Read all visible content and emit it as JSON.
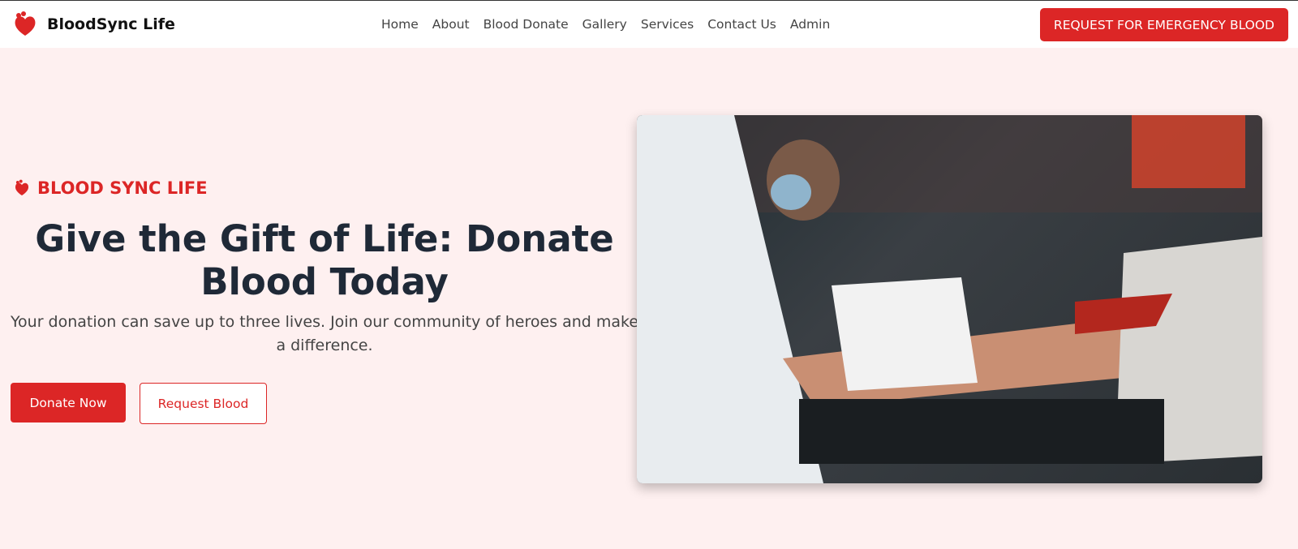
{
  "nav": {
    "brand": "BloodSync Life",
    "links": [
      "Home",
      "About",
      "Blood Donate",
      "Gallery",
      "Services",
      "Contact Us",
      "Admin"
    ],
    "emergency_button": "REQUEST FOR EMERGENCY BLOOD"
  },
  "hero": {
    "tag": "BLOOD SYNC LIFE",
    "title": "Give the Gift of Life: Donate Blood Today",
    "subtitle": "Your donation can save up to three lives. Join our community of heroes and make a difference.",
    "donate_button": "Donate Now",
    "request_button": "Request Blood"
  },
  "colors": {
    "accent": "#dc2626",
    "background": "#fef0f0"
  }
}
